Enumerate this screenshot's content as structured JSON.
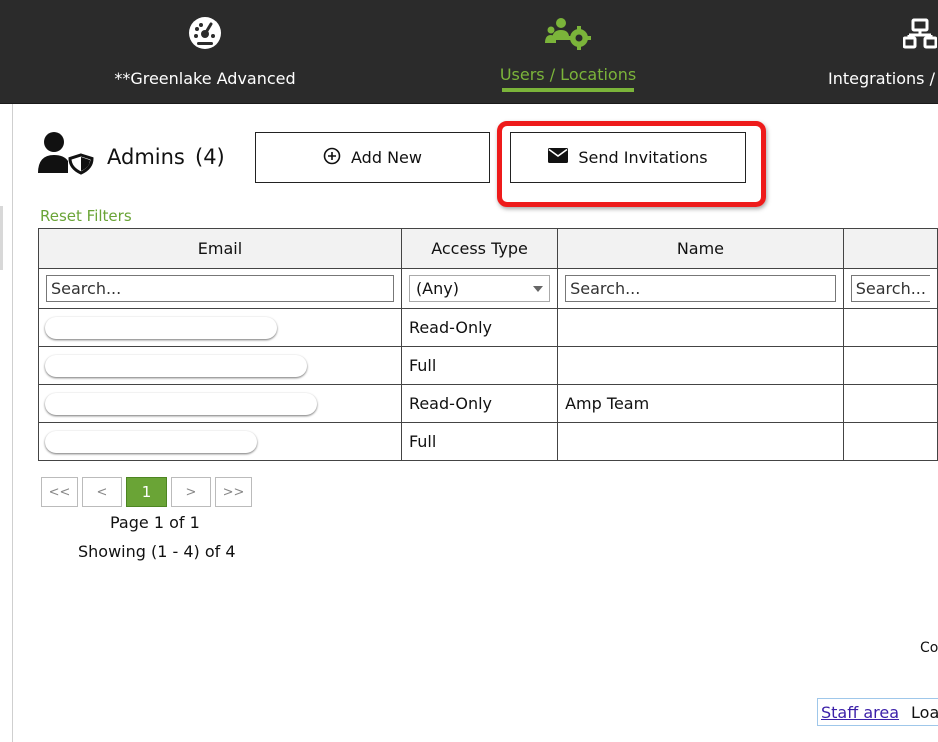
{
  "nav": {
    "items": [
      {
        "label": "**Greenlake Advanced",
        "icon": "dashboard-gauge-icon"
      },
      {
        "label": "Users / Locations",
        "icon": "users-gear-icon",
        "active": true
      },
      {
        "label": "Integrations / (",
        "icon": "network-icon"
      }
    ],
    "active_color": "#7bb43a"
  },
  "admins": {
    "title": "Admins",
    "count": "(4)",
    "icon": "user-shield-icon"
  },
  "buttons": {
    "add_new": "Add New",
    "send_invitations": "Send Invitations"
  },
  "reset_filters": "Reset Filters",
  "table": {
    "columns": [
      "Email",
      "Access Type",
      "Name",
      ""
    ],
    "filters": {
      "email_placeholder": "Search...",
      "access_selected": "(Any)",
      "name_placeholder": "Search...",
      "col4_placeholder": "Search..."
    },
    "rows": [
      {
        "access": "Read-Only",
        "name": ""
      },
      {
        "access": "Full",
        "name": ""
      },
      {
        "access": "Read-Only",
        "name": "Amp Team"
      },
      {
        "access": "Full",
        "name": ""
      }
    ]
  },
  "pagination": {
    "first": "<<",
    "prev": "<",
    "current": "1",
    "next": ">",
    "last": ">>",
    "page_of": "Page 1 of 1",
    "showing": "Showing (1 - 4) of 4"
  },
  "footer": {
    "co_fragment": "Co",
    "staff_area": "Staff area",
    "loa_fragment": "Loa"
  },
  "colors": {
    "nav_bg": "#2b2b2b",
    "accent_green": "#6aa436",
    "highlight_red": "#ee1b1b"
  }
}
